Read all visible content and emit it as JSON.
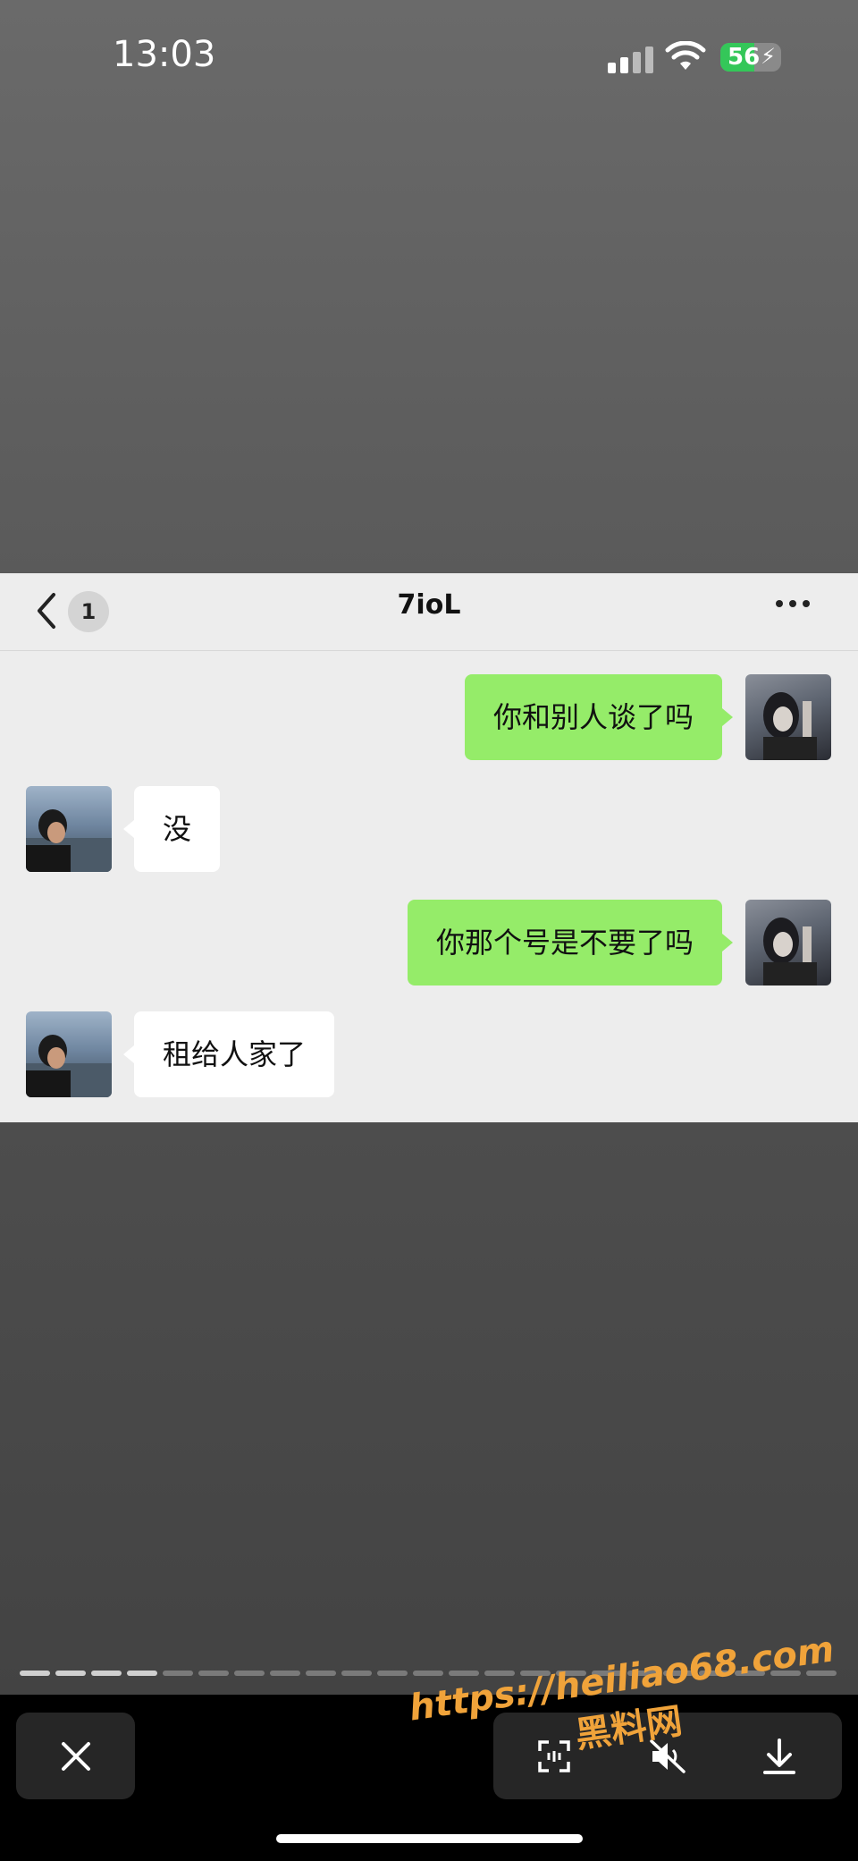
{
  "status_bar": {
    "time": "13:03",
    "battery": "56",
    "battery_level": 0.56
  },
  "chat": {
    "title": "7ioL",
    "unread_count": "1",
    "messages": [
      {
        "side": "me",
        "text": "你和别人谈了吗"
      },
      {
        "side": "other",
        "text": "没"
      },
      {
        "side": "me",
        "text": "你那个号是不要了吗"
      },
      {
        "side": "other",
        "text": "租给人家了"
      }
    ]
  },
  "viewer": {
    "total_pages": 23,
    "current_page": 4
  },
  "watermark": {
    "url": "https://heiliao68.com",
    "name": "黑料网"
  },
  "colors": {
    "my_bubble": "#95ec69",
    "other_bubble": "#ffffff",
    "chat_bg": "#ededed",
    "watermark": "#f0a33a"
  },
  "icons": [
    "back-arrow-icon",
    "more-dots-icon",
    "close-icon",
    "scan-icon",
    "mute-icon",
    "download-icon"
  ]
}
